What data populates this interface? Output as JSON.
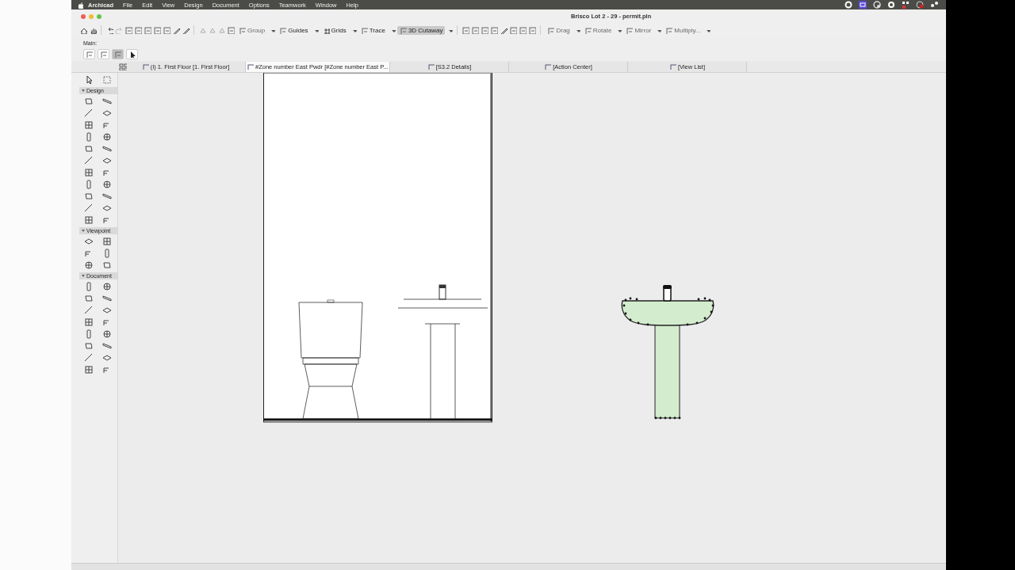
{
  "menu_bar": {
    "app": "Archicad",
    "items": [
      "File",
      "Edit",
      "View",
      "Design",
      "Document",
      "Options",
      "Teamwork",
      "Window",
      "Help"
    ]
  },
  "window": {
    "title": "Brisco Lot 2 - 29 - permit.pln"
  },
  "toolbar": {
    "buttons": [
      {
        "label": "Group",
        "selected": false,
        "disabled": true
      },
      {
        "label": "Guides",
        "selected": false,
        "disabled": false
      },
      {
        "label": "Grids",
        "selected": false,
        "disabled": false
      },
      {
        "label": "Trace",
        "selected": false,
        "disabled": false
      },
      {
        "label": "3D Cutaway",
        "selected": true,
        "disabled": false
      },
      {
        "label": "Drag",
        "selected": false,
        "disabled": true
      },
      {
        "label": "Rotate",
        "selected": false,
        "disabled": true
      },
      {
        "label": "Mirror",
        "selected": false,
        "disabled": true
      },
      {
        "label": "Multiply...",
        "selected": false,
        "disabled": true
      }
    ]
  },
  "info_box": {
    "label": "Main:"
  },
  "tabs": [
    {
      "label": "(I) 1. First Floor [1. First Floor]",
      "selected": false
    },
    {
      "label": "#Zone number East Pwdr [#Zone number East P...",
      "selected": true
    },
    {
      "label": "[S3.2 Details]",
      "selected": false
    },
    {
      "label": "[Action Center]",
      "selected": false
    },
    {
      "label": "[View List]",
      "selected": false
    }
  ],
  "toolbox": {
    "sections": [
      {
        "title": "Design",
        "expanded": true
      },
      {
        "title": "Viewpoint",
        "expanded": true
      },
      {
        "title": "Document",
        "expanded": true
      }
    ]
  }
}
